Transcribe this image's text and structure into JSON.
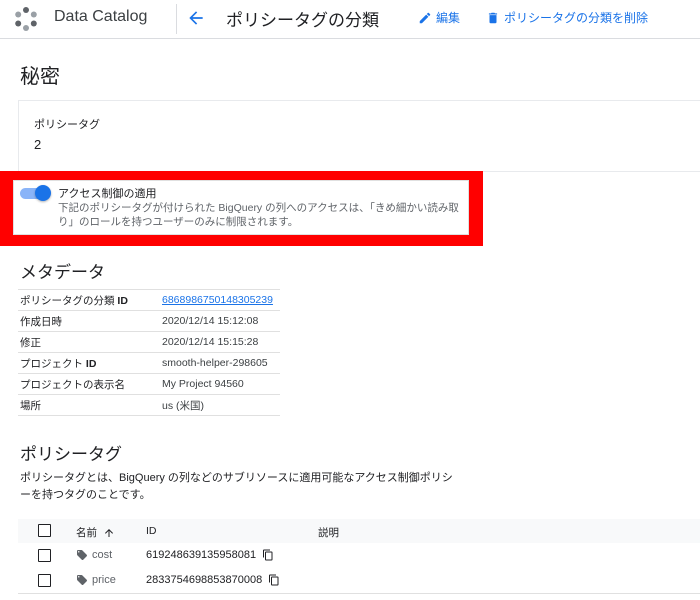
{
  "header": {
    "app_title": "Data Catalog",
    "page_title": "ポリシータグの分類",
    "edit_label": "編集",
    "delete_label": "ポリシータグの分類を削除",
    "colors": {
      "accent": "#1a73e8"
    }
  },
  "taxonomy": {
    "name": "秘密",
    "policy_tag_label": "ポリシータグ",
    "policy_tag_count": "2"
  },
  "access_control": {
    "enabled": true,
    "title": "アクセス制御の適用",
    "description": "下記のポリシータグが付けられた BigQuery の列へのアクセスは、「きめ細かい読み取り」のロールを持つユーザーのみに制限されます。"
  },
  "metadata": {
    "heading": "メタデータ",
    "rows": [
      {
        "key": "ポリシータグの分類 ",
        "key_bold": "ID",
        "value": "6868986750148305239",
        "link": true
      },
      {
        "key": "作成日時",
        "key_bold": "",
        "value": "2020/12/14 15:12:08",
        "link": false
      },
      {
        "key": "修正",
        "key_bold": "",
        "value": "2020/12/14 15:15:28",
        "link": false
      },
      {
        "key": "プロジェクト ",
        "key_bold": "ID",
        "value": "smooth-helper-298605",
        "link": false
      },
      {
        "key": "プロジェクトの表示名",
        "key_bold": "",
        "value": "My Project 94560",
        "link": false
      },
      {
        "key": "場所",
        "key_bold": "",
        "value": "us (米国)",
        "link": false
      }
    ]
  },
  "policy_tags": {
    "heading": "ポリシータグ",
    "description": "ポリシータグとは、BigQuery の列などのサブリソースに適用可能なアクセス制御ポリシーを持つタグのことです。",
    "columns": {
      "name": "名前",
      "id": "ID",
      "description": "説明"
    },
    "rows": [
      {
        "name": "cost",
        "id": "619248639135958081"
      },
      {
        "name": "price",
        "id": "2833754698853870008"
      }
    ]
  }
}
